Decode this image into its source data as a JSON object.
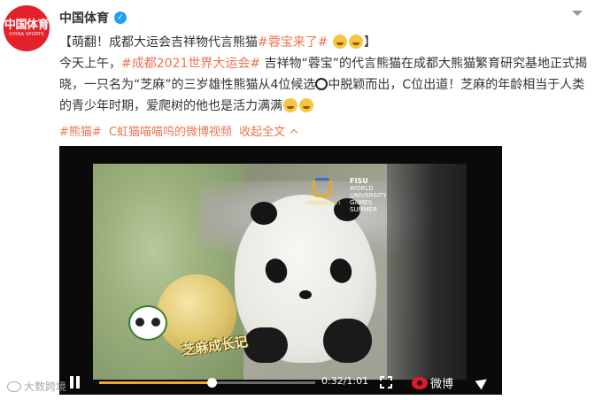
{
  "account": {
    "avatar_text_cn": "中国体育",
    "avatar_text_en": "CHINA SPORTS",
    "name": "中国体育",
    "verified": true
  },
  "post": {
    "line1_prefix": "【萌翻！成都大运会吉祥物代言熊猫",
    "line1_hashtag": "#蓉宝来了#",
    "line1_suffix": "】",
    "line2_prefix": "今天上午，",
    "line2_hashtag": "#成都2021世界大运会#",
    "line2_suffix": " 吉祥物“蓉宝”的代言熊猫在成都大熊猫繁育研究基地正式揭",
    "line3_prefix": "晓，一只名为“芝麻”的三岁雄性熊猫从4位候选",
    "line3_suffix": "中脱颖而出，C位出道！芝麻的年龄相当于人类",
    "line4": "的青少年时期，爱爬树的他也是活力满满",
    "emoji_name": "laughing-emoji",
    "panda_emoji_name": "panda-emoji"
  },
  "footer": {
    "hashtag": "#熊猫#",
    "video_link": "C虹猫喵喵呜的微博视频",
    "collapse": "收起全文"
  },
  "video": {
    "overlay_title": "芝麻成长记",
    "sponsor_name": "FISU",
    "sponsor_line1": "WORLD",
    "sponsor_line2": "UNIVERSITY",
    "sponsor_line3": "GAMES",
    "sponsor_line4": "SUMMER",
    "event_logo_text": "CHENGDU 2021",
    "current_time": "0:32",
    "duration": "1:01",
    "time_separator": "/",
    "progress_fraction": 0.52,
    "brand_label": "微博",
    "playing": true
  },
  "watermark": {
    "text": "大数跨境"
  },
  "colors": {
    "accent": "#eb7350",
    "avatar_red": "#e4202b",
    "verified_blue": "#1da1f2",
    "progress": "#f5a623"
  }
}
